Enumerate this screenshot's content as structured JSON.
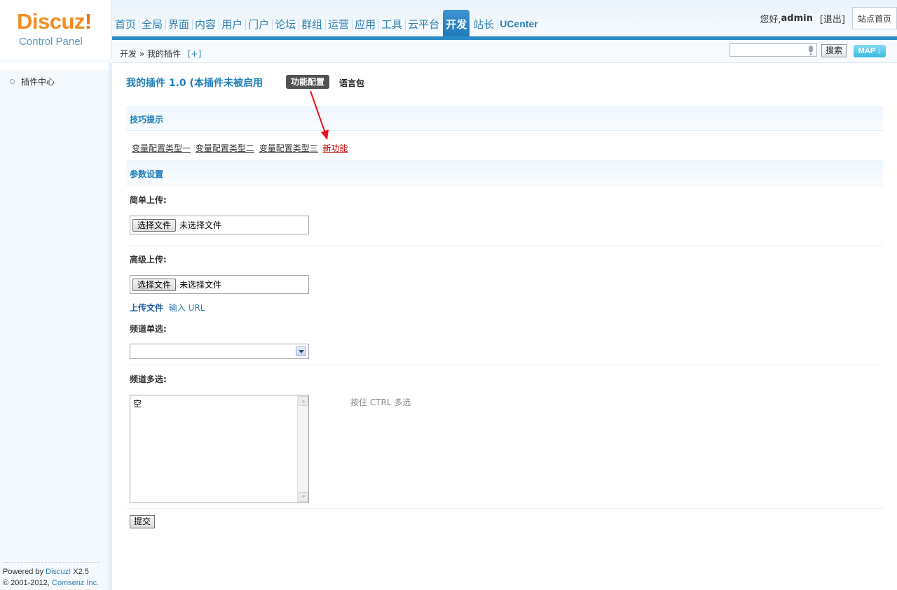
{
  "logo": {
    "brand": "Discuz",
    "bang": "!",
    "subtitle": "Control Panel"
  },
  "topnav": {
    "items": [
      {
        "label": "首页"
      },
      {
        "label": "全局"
      },
      {
        "label": "界面"
      },
      {
        "label": "内容"
      },
      {
        "label": "用户"
      },
      {
        "label": "门户"
      },
      {
        "label": "论坛"
      },
      {
        "label": "群组"
      },
      {
        "label": "运营"
      },
      {
        "label": "应用"
      },
      {
        "label": "工具"
      },
      {
        "label": "云平台"
      },
      {
        "label": "开发"
      },
      {
        "label": "站长"
      },
      {
        "label": "UCenter"
      }
    ],
    "active": "开发"
  },
  "user": {
    "greeting": "您好,",
    "name": "admin",
    "logout": "[退出]",
    "home": "站点首页"
  },
  "breadcrumb": {
    "section": "开发",
    "sep": "»",
    "page": "我的插件",
    "add": "[+]"
  },
  "search": {
    "value": "",
    "button": "搜索",
    "map": "MAP"
  },
  "sidebar": {
    "items": [
      {
        "label": "插件中心"
      }
    ]
  },
  "footer": {
    "powered": "Powered by",
    "brand": "Discuz!",
    "version": "X2.5",
    "copyright": "© 2001-2012,",
    "company": "Comsenz Inc."
  },
  "page": {
    "title": "我的插件 1.0 (本插件未被启用",
    "tabs": {
      "func": "功能配置",
      "lang": "语言包"
    },
    "tips_header": "技巧提示",
    "tips": [
      "变量配置类型一",
      "变量配置类型二",
      "变量配置类型三",
      "新功能"
    ],
    "params_header": "参数设置",
    "simple_upload": {
      "label": "简单上传:",
      "button": "选择文件",
      "status": "未选择文件"
    },
    "advanced_upload": {
      "label": "高级上传:",
      "button": "选择文件",
      "status": "未选择文件",
      "link_upload": "上传文件",
      "link_url": "输入 URL"
    },
    "channel_single": {
      "label": "频道单选:",
      "selected": ""
    },
    "channel_multi": {
      "label": "频道多选:",
      "options": [
        "空"
      ],
      "hint": "按住 CTRL 多选"
    },
    "submit": "提交"
  },
  "colors": {
    "accent": "#2a8ac6",
    "brand_orange": "#f28d22",
    "link": "#2f7fb2",
    "annotation_red": "#e8141b"
  }
}
